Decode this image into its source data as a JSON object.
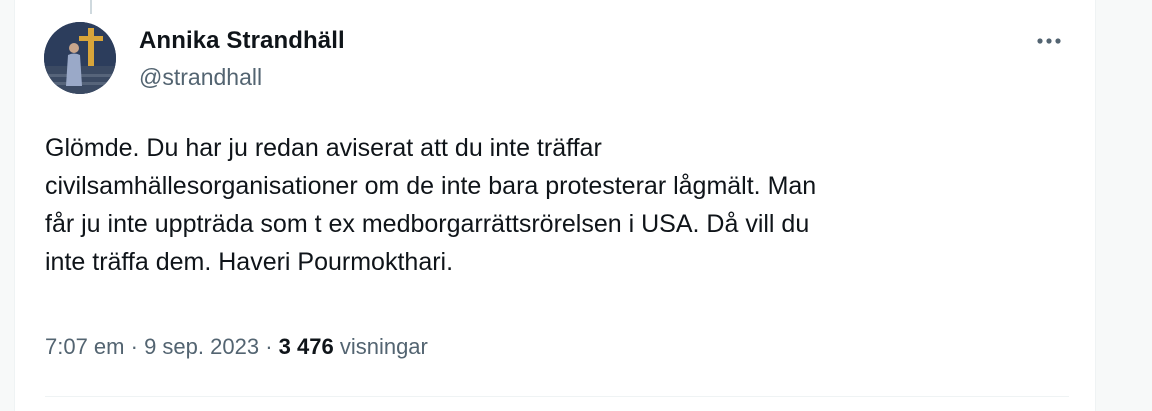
{
  "author": {
    "name": "Annika Strandhäll",
    "handle": "@strandhall"
  },
  "tweet": {
    "lines": [
      "Glömde. Du har ju redan aviserat att du inte träffar",
      "civilsamhällesorganisationer om de inte bara protesterar lågmält. Man",
      "får ju inte uppträda som t ex medborgarrättsrörelsen i USA. Då vill du",
      "inte träffa dem. Haveri Pourmokthari."
    ]
  },
  "meta": {
    "time": "7:07 em",
    "separator": "·",
    "date": "9 sep. 2023",
    "views_count": "3 476",
    "views_label": "visningar"
  },
  "icons": {
    "more": "more-horizontal-icon"
  },
  "colors": {
    "text_primary": "#0f1419",
    "text_secondary": "#536471",
    "divider": "#eff3f4"
  }
}
